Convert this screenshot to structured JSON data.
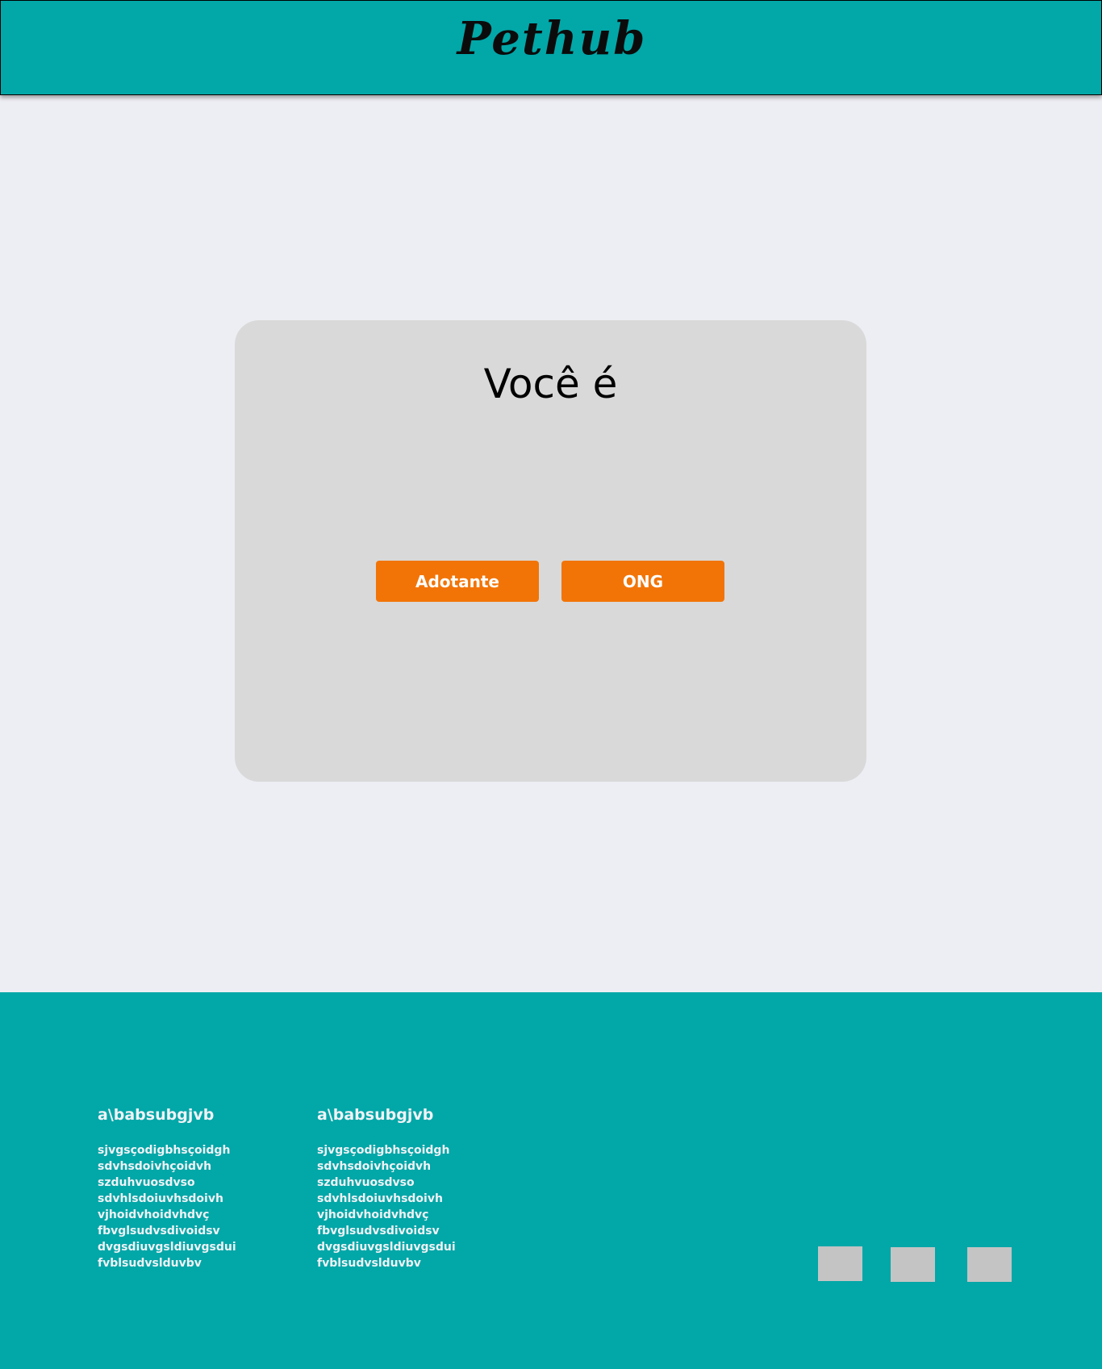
{
  "header": {
    "logo": "Pethub"
  },
  "card": {
    "title": "Você é",
    "buttons": {
      "adotante": "Adotante",
      "ong": "ONG"
    }
  },
  "footer": {
    "columns": [
      {
        "heading": "a\\babsubgjvb",
        "lines": [
          "sjvgsçodigbhsçoidgh",
          "sdvhsdoivhçoidvh",
          "szduhvuosdvso",
          "sdvhlsdoiuvhsdoivh",
          "vjhoidvhoidvhdvç",
          "fbvglsudvsdivoidsv",
          "dvgsdiuvgsldiuvgsdui",
          "fvblsudvsldu​vbv"
        ]
      },
      {
        "heading": "a\\babsubgjvb",
        "lines": [
          "sjvgsçodigbhsçoidgh",
          "sdvhsdoivhçoidvh",
          "szduhvuosdvso",
          "sdvhlsdoiuvhsdoivh",
          "vjhoidvhoidvhdvç",
          "fbvglsudvsdivoidsv",
          "dvgsdiuvgsldiuvgsdui",
          "fvblsudvsldu​vbv"
        ]
      }
    ],
    "social_icons": [
      "social-icon-placeholder",
      "social-icon-placeholder",
      "social-icon-placeholder"
    ]
  },
  "colors": {
    "teal": "#02A7A8",
    "background": "#EDEEF3",
    "card": "#D9D9D9",
    "button": "#F27407",
    "placeholder": "#C4C4C4"
  }
}
